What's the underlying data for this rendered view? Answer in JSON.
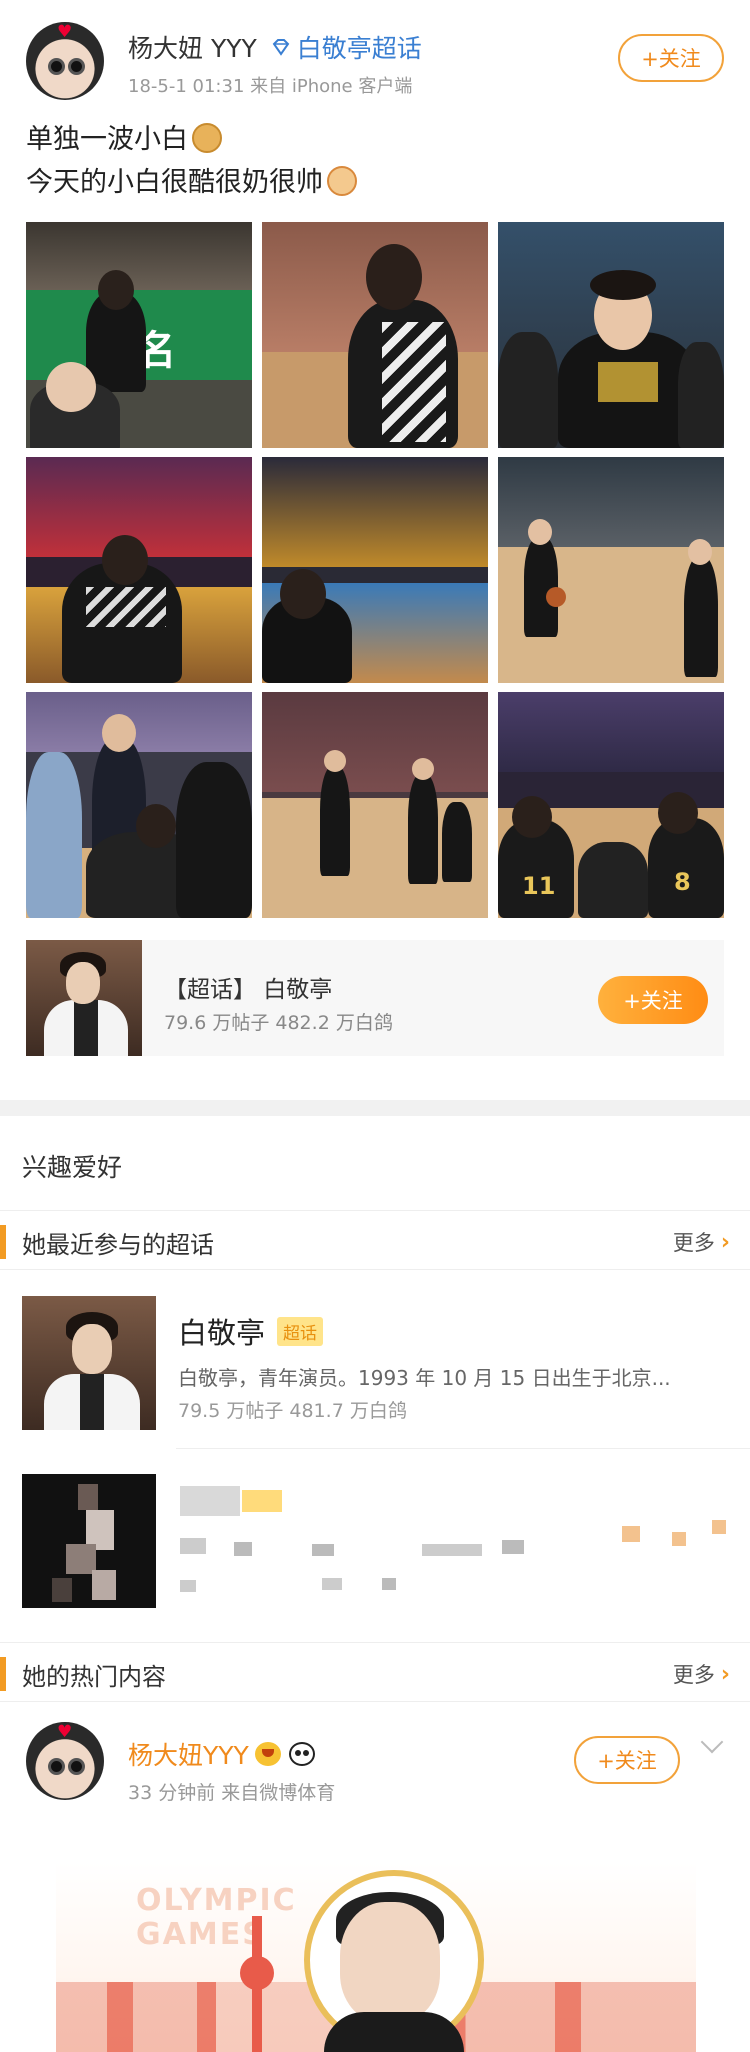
{
  "post": {
    "author": "杨大妞 YYY",
    "topic_tag": "白敬亭超话",
    "time": "18-5-1 01:31",
    "source": "来自 iPhone 客户端",
    "follow_label": "+关注",
    "text_line1": "单独一波小白",
    "text_line2": "今天的小白很酷很奶很帅",
    "emoji1": "doge-face-icon",
    "emoji2": "cat-face-icon",
    "photo_count": 9
  },
  "topic_card": {
    "title": "【超话】 白敬亭",
    "stats": "79.6 万帖子  482.2 万白鸽",
    "follow_label": "+关注"
  },
  "interests": {
    "section_title": "兴趣爱好",
    "recent_header": "她最近参与的超话",
    "more_label": "更多",
    "item1": {
      "name": "白敬亭",
      "badge": "超话",
      "desc": "白敬亭，青年演员。1993 年 10 月 15 日出生于北京...",
      "stats": "79.5 万帖子  481.7 万白鸽"
    }
  },
  "hot": {
    "header": "她的热门内容",
    "more_label": "更多",
    "author": "杨大妞YYY",
    "meta": "33 分钟前   来自微博体育",
    "follow_label": "+关注",
    "banner_text_1": "OLYMPIC",
    "banner_text_2": "GAMES"
  },
  "colors": {
    "accent_orange": "#f08a1c",
    "link_blue": "#3a7fd2",
    "badge_yellow": "#ffe48a"
  }
}
